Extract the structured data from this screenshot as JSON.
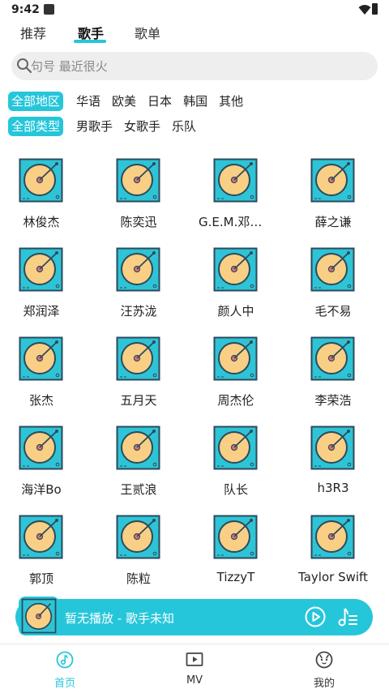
{
  "status_bar": {
    "time": "9:42"
  },
  "tabs": [
    {
      "label": "推荐"
    },
    {
      "label": "歌手"
    },
    {
      "label": "歌单"
    }
  ],
  "active_tab": 1,
  "search": {
    "placeholder": "句号 最近很火"
  },
  "filters": {
    "region": [
      "全部地区",
      "华语",
      "欧美",
      "日本",
      "韩国",
      "其他"
    ],
    "type": [
      "全部类型",
      "男歌手",
      "女歌手",
      "乐队"
    ]
  },
  "artists": [
    "林俊杰",
    "陈奕迅",
    "G.E.M.邓紫棋",
    "薛之谦",
    "郑润泽",
    "汪苏泷",
    "颜人中",
    "毛不易",
    "张杰",
    "五月天",
    "周杰伦",
    "李荣浩",
    "海洋Bo",
    "王贰浪",
    "队长",
    "h3R3",
    "郭顶",
    "陈粒",
    "TizzyT",
    "Taylor Swift"
  ],
  "player": {
    "now_playing": "暂无播放 - 歌手未知"
  },
  "bottom_nav": [
    {
      "label": "首页",
      "icon": "music-note-icon"
    },
    {
      "label": "MV",
      "icon": "video-play-icon"
    },
    {
      "label": "我的",
      "icon": "profile-face-icon"
    }
  ],
  "colors": {
    "accent": "#26c6da",
    "cover_bg": "#2ec4d6",
    "disc": "#f8cf85",
    "label": "#e57373"
  }
}
